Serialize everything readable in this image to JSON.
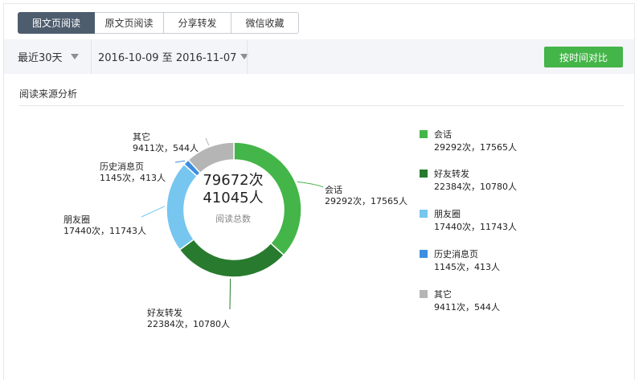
{
  "tabs": [
    {
      "label": "图文页阅读",
      "active": true
    },
    {
      "label": "原文页阅读",
      "active": false
    },
    {
      "label": "分享转发",
      "active": false
    },
    {
      "label": "微信收藏",
      "active": false
    }
  ],
  "filters": {
    "period": "最近30天",
    "date_range": "2016-10-09 至 2016-11-07",
    "compare_button": "按时间对比"
  },
  "section_title": "阅读来源分析",
  "center": {
    "total_times": "79672次",
    "total_people": "41045人",
    "caption": "阅读总数"
  },
  "chart_data": {
    "type": "donut",
    "series": [
      {
        "name": "会话",
        "times": 29292,
        "people": 17565,
        "display": "29292次，17565人",
        "color": "#44b549"
      },
      {
        "name": "好友转发",
        "times": 22384,
        "people": 10780,
        "display": "22384次，10780人",
        "color": "#287b2e"
      },
      {
        "name": "朋友圈",
        "times": 17440,
        "people": 11743,
        "display": "17440次，11743人",
        "color": "#76c6f0"
      },
      {
        "name": "历史消息页",
        "times": 1145,
        "people": 413,
        "display": "1145次，413人",
        "color": "#3d8ee0"
      },
      {
        "name": "其它",
        "times": 9411,
        "people": 544,
        "display": "9411次，544人",
        "color": "#b5b5b5"
      }
    ]
  }
}
